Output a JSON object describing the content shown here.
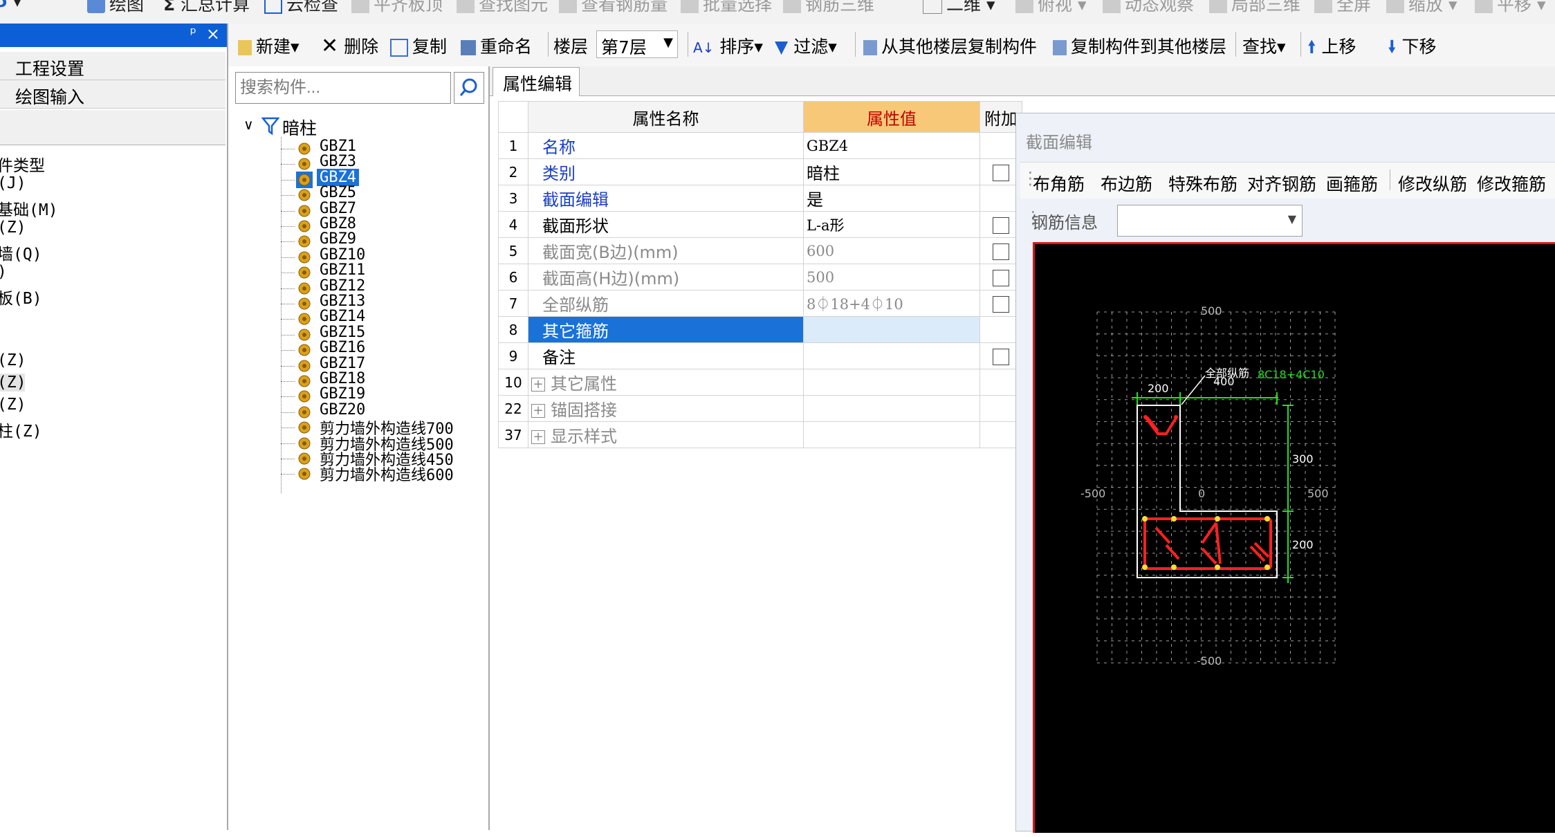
{
  "top_toolbar": {
    "items": [
      "绘图",
      "汇总计算",
      "云检查",
      "平齐板顶",
      "查找图元",
      "查看钢筋量",
      "批量选择",
      "钢筋三维",
      "二维",
      "俯视",
      "动态观察",
      "局部三维",
      "全屏",
      "缩放",
      "平移"
    ]
  },
  "left_panel": {
    "pin": "ᵖ",
    "close": "×",
    "project_settings": "工程设置",
    "drawing_input": "绘图输入",
    "items": [
      "件类型",
      "(J)",
      "基础(M)",
      "(Z)",
      "墙(Q)",
      ")",
      "板(B)",
      "(Z)",
      "(Z)",
      "(Z)",
      "柱(Z)"
    ]
  },
  "toolbar2": {
    "new": "新建",
    "delete": "删除",
    "copy": "复制",
    "rename": "重命名",
    "floor_label": "楼层",
    "floor_value": "第7层",
    "sort": "排序",
    "filter": "过滤",
    "copy_from": "从其他楼层复制构件",
    "copy_to": "复制构件到其他楼层",
    "find": "查找",
    "move_up": "上移",
    "move_down": "下移"
  },
  "tree": {
    "search_placeholder": "搜索构件...",
    "root": "暗柱",
    "items": [
      "GBZ1",
      "GBZ3",
      "GBZ4",
      "GBZ5",
      "GBZ7",
      "GBZ8",
      "GBZ9",
      "GBZ10",
      "GBZ11",
      "GBZ12",
      "GBZ13",
      "GBZ14",
      "GBZ15",
      "GBZ16",
      "GBZ17",
      "GBZ18",
      "GBZ19",
      "GBZ20",
      "剪力墙外构造线700",
      "剪力墙外构造线500",
      "剪力墙外构造线450",
      "剪力墙外构造线600"
    ],
    "selected": "GBZ4"
  },
  "tabs": {
    "property_edit": "属性编辑"
  },
  "prop_table": {
    "headers": {
      "name": "属性名称",
      "value": "属性值",
      "extra": "附加"
    },
    "rows": [
      {
        "no": "1",
        "name": "名称",
        "value": "GBZ4"
      },
      {
        "no": "2",
        "name": "类别",
        "value": "暗柱"
      },
      {
        "no": "3",
        "name": "截面编辑",
        "value": "是"
      },
      {
        "no": "4",
        "name": "截面形状",
        "value": "L-a形"
      },
      {
        "no": "5",
        "name": "截面宽(B边)(mm)",
        "value": "600"
      },
      {
        "no": "6",
        "name": "截面高(H边)(mm)",
        "value": "500"
      },
      {
        "no": "7",
        "name": "全部纵筋",
        "value": "8⏀18+4⏀10"
      },
      {
        "no": "8",
        "name": "其它箍筋",
        "value": ""
      },
      {
        "no": "9",
        "name": "备注",
        "value": ""
      },
      {
        "no": "10",
        "name": "其它属性",
        "value": ""
      },
      {
        "no": "22",
        "name": "锚固搭接",
        "value": ""
      },
      {
        "no": "37",
        "name": "显示样式",
        "value": ""
      }
    ]
  },
  "section_editor": {
    "title": "截面编辑",
    "tools": [
      "布角筋",
      "布边筋",
      "特殊布筋",
      "对齐钢筋",
      "画箍筋",
      "修改纵筋",
      "修改箍筋"
    ],
    "rebar_info_label": "钢筋信息",
    "canvas": {
      "grid_500_top": "500",
      "grid_500_bottom": "-500",
      "grid_left": "-500",
      "grid_right": "500",
      "origin": "0",
      "dim_top_200": "200",
      "dim_top_400": "400",
      "dim_right_300": "300",
      "dim_right_200": "200",
      "leader_label": "全部纵筋",
      "rebar_label": "8C18+4C10",
      "colors": {
        "section": "#ffffff",
        "rebar": "#ff2020",
        "dims": "#22e022",
        "grid": "#9a9a9a"
      }
    }
  }
}
